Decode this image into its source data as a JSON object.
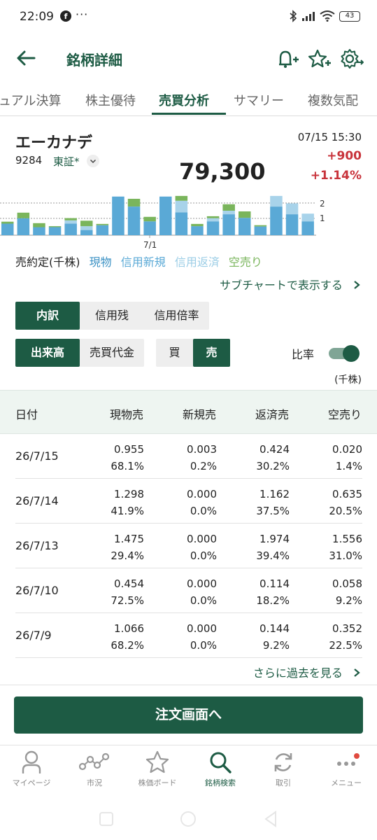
{
  "status": {
    "time": "22:09",
    "fb": "f",
    "more": "···",
    "battery": "43"
  },
  "header": {
    "title": "銘柄詳細"
  },
  "tabs": [
    "ュアル決算",
    "株主優待",
    "売買分析",
    "サマリー",
    "複数気配"
  ],
  "stock": {
    "name": "エーカナデ",
    "code": "9284",
    "market": "東証*",
    "price": "79,300",
    "datetime": "07/15 15:30",
    "change": "+900",
    "change_pct": "+1.14%"
  },
  "mini_chart": {
    "axis_labels": [
      "2",
      "1"
    ],
    "date_label": "7/1",
    "bars": [
      {
        "blue": 0.72,
        "light": 0.0,
        "green": 0.12
      },
      {
        "blue": 1.05,
        "light": 0.0,
        "green": 0.35
      },
      {
        "blue": 0.5,
        "light": 0.0,
        "green": 0.25
      },
      {
        "blue": 0.5,
        "light": 0.0,
        "green": 0.06
      },
      {
        "blue": 0.72,
        "light": 0.2,
        "green": 0.14
      },
      {
        "blue": 0.32,
        "light": 0.24,
        "green": 0.34
      },
      {
        "blue": 0.62,
        "light": 0.0,
        "green": 0.08
      },
      {
        "blue": 2.4,
        "light": 0.0,
        "green": 0.0
      },
      {
        "blue": 1.78,
        "light": 0.0,
        "green": 0.48
      },
      {
        "blue": 0.86,
        "light": 0.0,
        "green": 0.28
      },
      {
        "blue": 2.4,
        "light": 0.0,
        "green": 0.0
      },
      {
        "blue": 1.42,
        "light": 0.72,
        "green": 0.3
      },
      {
        "blue": 0.56,
        "light": 0.0,
        "green": 0.14
      },
      {
        "blue": 0.86,
        "light": 0.2,
        "green": 0.12
      },
      {
        "blue": 1.3,
        "light": 0.22,
        "green": 0.4
      },
      {
        "blue": 1.08,
        "light": 0.0,
        "green": 0.4
      },
      {
        "blue": 0.54,
        "light": 0.0,
        "green": 0.08
      },
      {
        "blue": 1.78,
        "light": 0.66,
        "green": 0.0
      },
      {
        "blue": 1.3,
        "light": 0.68,
        "green": 0.0
      },
      {
        "blue": 0.86,
        "light": 0.48,
        "green": 0.0
      }
    ]
  },
  "legend": {
    "label": "売約定(千株)",
    "items": [
      "現物",
      "信用新規",
      "信用返済",
      "空売り"
    ]
  },
  "colors": {
    "accent": "#1d5b44",
    "up": "#c8333b",
    "genbutsu": "#5aa9d6",
    "shinki": "#7ac1e0",
    "hensai": "#a8d3ea",
    "karauri": "#7ab55c"
  },
  "subchart_link": "サブチャートで表示する",
  "segments": {
    "view": [
      "内訳",
      "信用残",
      "信用倍率"
    ],
    "measure": [
      "出来高",
      "売買代金"
    ],
    "side": [
      "買",
      "売"
    ]
  },
  "ratio_label": "比率",
  "unit_label": "(千株)",
  "table": {
    "headers": [
      "日付",
      "現物売",
      "新規売",
      "返済売",
      "空売り"
    ],
    "rows": [
      {
        "date": "26/7/15",
        "v": [
          "0.955",
          "0.003",
          "0.424",
          "0.020"
        ],
        "p": [
          "68.1%",
          "0.2%",
          "30.2%",
          "1.4%"
        ]
      },
      {
        "date": "26/7/14",
        "v": [
          "1.298",
          "0.000",
          "1.162",
          "0.635"
        ],
        "p": [
          "41.9%",
          "0.0%",
          "37.5%",
          "20.5%"
        ]
      },
      {
        "date": "26/7/13",
        "v": [
          "1.475",
          "0.000",
          "1.974",
          "1.556"
        ],
        "p": [
          "29.4%",
          "0.0%",
          "39.4%",
          "31.0%"
        ]
      },
      {
        "date": "26/7/10",
        "v": [
          "0.454",
          "0.000",
          "0.114",
          "0.058"
        ],
        "p": [
          "72.5%",
          "0.0%",
          "18.2%",
          "9.2%"
        ]
      },
      {
        "date": "26/7/9",
        "v": [
          "1.066",
          "0.000",
          "0.144",
          "0.352"
        ],
        "p": [
          "68.2%",
          "0.0%",
          "9.2%",
          "22.5%"
        ]
      }
    ]
  },
  "more_link": "さらに過去を見る",
  "order_button": "注文画面へ",
  "bottom_nav": [
    "マイページ",
    "市況",
    "株価ボード",
    "銘柄検索",
    "取引",
    "メニュー"
  ]
}
